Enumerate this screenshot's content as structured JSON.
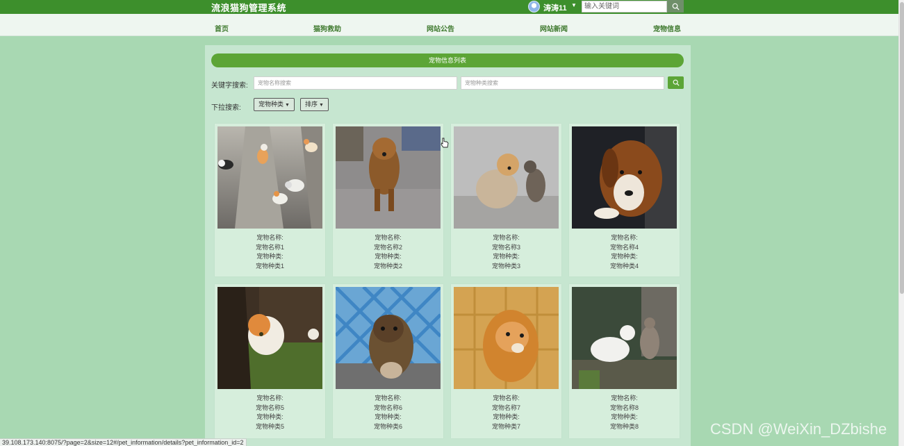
{
  "header": {
    "site_title": "流浪猫狗管理系统",
    "username": "涛涛11",
    "search_placeholder": "输入关键词"
  },
  "nav": {
    "items": [
      "首页",
      "猫狗救助",
      "网站公告",
      "网站新闻",
      "宠物信息"
    ]
  },
  "main": {
    "list_title": "宠物信息列表",
    "keyword_label": "关键字搜索:",
    "name_search_placeholder": "宠物名称搜索",
    "type_search_placeholder": "宠物种类搜索",
    "dropdown_label": "下拉搜索:",
    "type_dropdown": "宠物种类",
    "sort_dropdown": "排序"
  },
  "pets": [
    {
      "name_label": "宠物名称:",
      "name": "宠物名称1",
      "type_label": "宠物种类:",
      "type": "宠物种类1"
    },
    {
      "name_label": "宠物名称:",
      "name": "宠物名称2",
      "type_label": "宠物种类:",
      "type": "宠物种类2"
    },
    {
      "name_label": "宠物名称:",
      "name": "宠物名称3",
      "type_label": "宠物种类:",
      "type": "宠物种类3"
    },
    {
      "name_label": "宠物名称:",
      "name": "宠物名称4",
      "type_label": "宠物种类:",
      "type": "宠物种类4"
    },
    {
      "name_label": "宠物名称:",
      "name": "宠物名称5",
      "type_label": "宠物种类:",
      "type": "宠物种类5"
    },
    {
      "name_label": "宠物名称:",
      "name": "宠物名称6",
      "type_label": "宠物种类:",
      "type": "宠物种类6"
    },
    {
      "name_label": "宠物名称:",
      "name": "宠物名称7",
      "type_label": "宠物种类:",
      "type": "宠物种类7"
    },
    {
      "name_label": "宠物名称:",
      "name": "宠物名称8",
      "type_label": "宠物种类:",
      "type": "宠物种类8"
    }
  ],
  "status_bar": {
    "url": "39.108.173.140:8075/?page=2&size=12#/pet_information/details?pet_information_id=2"
  },
  "watermark": "CSDN @WeiXin_DZbishe",
  "colors": {
    "topbar": "#3d8f2c",
    "accent": "#5ca536",
    "page_bg": "#a8d8b2",
    "panel_bg": "#c6e6d0"
  }
}
